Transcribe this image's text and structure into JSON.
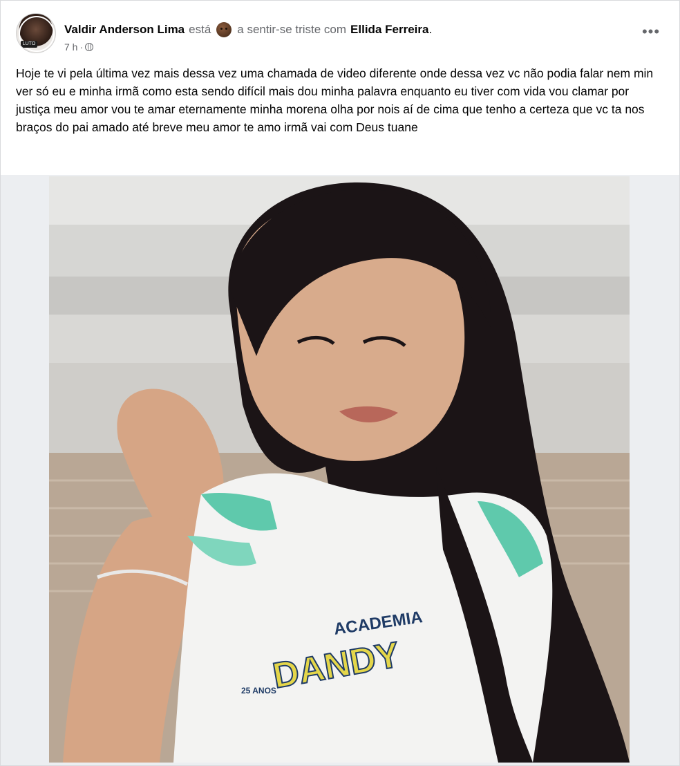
{
  "post": {
    "author": "Valdir Anderson Lima",
    "is_text": "está",
    "feeling_icon": "sad-face-emoji-icon",
    "feeling_text": "a sentir-se triste com",
    "tagged": "Ellida Ferreira",
    "tagged_suffix": ".",
    "timestamp": "7 h",
    "separator": "·",
    "privacy_icon": "globe-icon",
    "more_icon": "more-options-icon",
    "more_label": "•••",
    "avatar_badge": "LUTO",
    "text": "Hoje te vi pela última vez mais dessa vez uma chamada de video diferente onde dessa vez vc não podia falar nem min ver só eu e minha irmã como esta sendo difícil mais dou minha palavra enquanto eu tiver com vida vou clamar por justiça meu amor vou te amar eternamente minha morena olha por nois aí de cima que tenho a certeza que vc ta nos braços do pai amado até breve meu amor te amo irmã vai com Deus tuane"
  },
  "photo": {
    "shirt_text_top": "ACADEMIA",
    "shirt_text_brand": "DANDY",
    "shirt_badge": "25 ANOS"
  },
  "colors": {
    "text": "#050505",
    "muted": "#65676b",
    "media_bg": "#eceef1"
  }
}
